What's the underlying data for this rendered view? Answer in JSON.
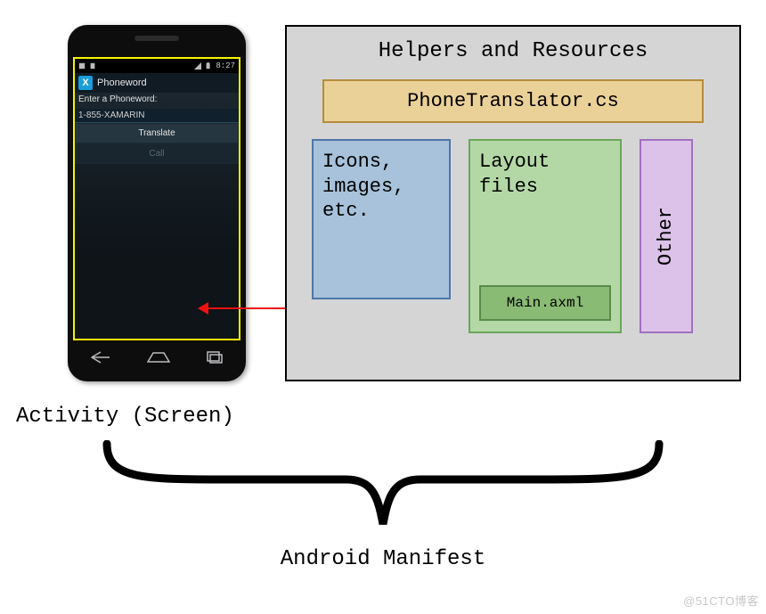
{
  "phone": {
    "status": {
      "time": "8:27",
      "battery_icon": "battery-icon",
      "signal_icon": "signal-icon"
    },
    "app": {
      "icon_letter": "X",
      "title": "Phoneword",
      "prompt": "Enter a Phoneword:",
      "input_value": "1-855-XAMARIN",
      "translate_btn": "Translate",
      "call_btn": "Call"
    },
    "nav": {
      "back": "back-icon",
      "home": "home-icon",
      "recent": "recent-icon"
    }
  },
  "panel": {
    "title": "Helpers and Resources",
    "translator_file": "PhoneTranslator.cs",
    "icons_card_line1": "Icons,",
    "icons_card_line2": "images,",
    "icons_card_line3": "etc.",
    "layout_card_line1": "Layout",
    "layout_card_line2": "files",
    "layout_file": "Main.axml",
    "other_card": "Other"
  },
  "labels": {
    "activity": "Activity (Screen)",
    "manifest": "Android Manifest"
  },
  "watermark": "@51CTO博客"
}
